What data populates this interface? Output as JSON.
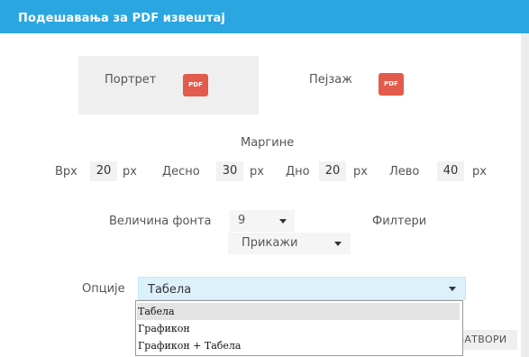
{
  "dialog": {
    "title": "Подешавања за PDF извештај"
  },
  "orientation": {
    "portrait_label": "Портрет",
    "landscape_label": "Пејзаж",
    "icon_text": "PDF"
  },
  "margins": {
    "title": "Маргине",
    "unit": "px",
    "top": {
      "label": "Врх",
      "value": "20"
    },
    "right": {
      "label": "Десно",
      "value": "30"
    },
    "bottom": {
      "label": "Дно",
      "value": "20"
    },
    "left": {
      "label": "Лево",
      "value": "40"
    }
  },
  "font_size": {
    "label": "Величина фонта",
    "value": "9"
  },
  "filters": {
    "label": "Филтери",
    "value": "Прикажи"
  },
  "options": {
    "label": "Опције",
    "selected": "Табела",
    "items": [
      "Табела",
      "Графикон",
      "Графикон + Табела"
    ]
  },
  "footer": {
    "close_label": "ЗАТВОРИ"
  },
  "colors": {
    "header": "#2aa7e0",
    "pdf_icon": "#e25b4c",
    "options_field": "#ddf1fb"
  }
}
